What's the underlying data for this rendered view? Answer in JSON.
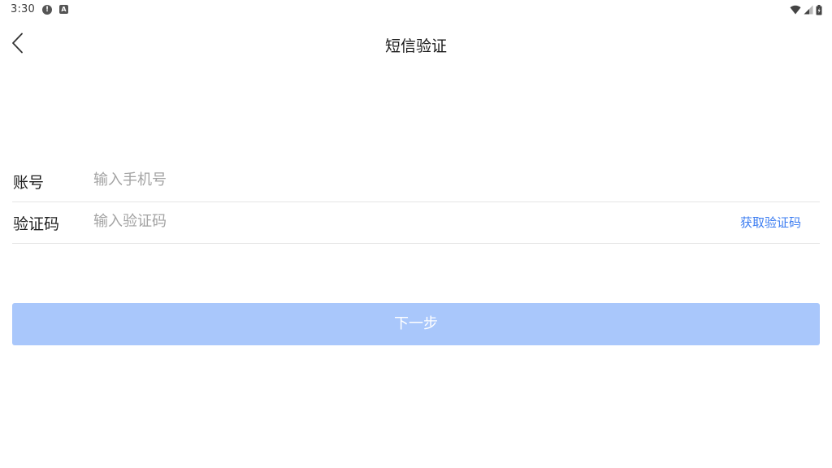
{
  "status_bar": {
    "time": "3:30",
    "alert_icon": "alert-circle-icon",
    "a_icon_glyph": "A",
    "alert_glyph": "!",
    "icons": [
      "wifi-icon",
      "signal-icon",
      "battery-icon"
    ]
  },
  "header": {
    "back_icon": "chevron-left-icon",
    "title": "短信验证"
  },
  "form": {
    "account": {
      "label": "账号",
      "value": "",
      "placeholder": "输入手机号"
    },
    "code": {
      "label": "验证码",
      "value": "",
      "placeholder": "输入验证码",
      "get_code_label": "获取验证码"
    }
  },
  "next_button": {
    "label": "下一步"
  },
  "colors": {
    "link": "#3b7cf1",
    "button_bg": "#a9c7fb",
    "divider": "#e4e4e4",
    "placeholder": "#a3a3a3"
  }
}
